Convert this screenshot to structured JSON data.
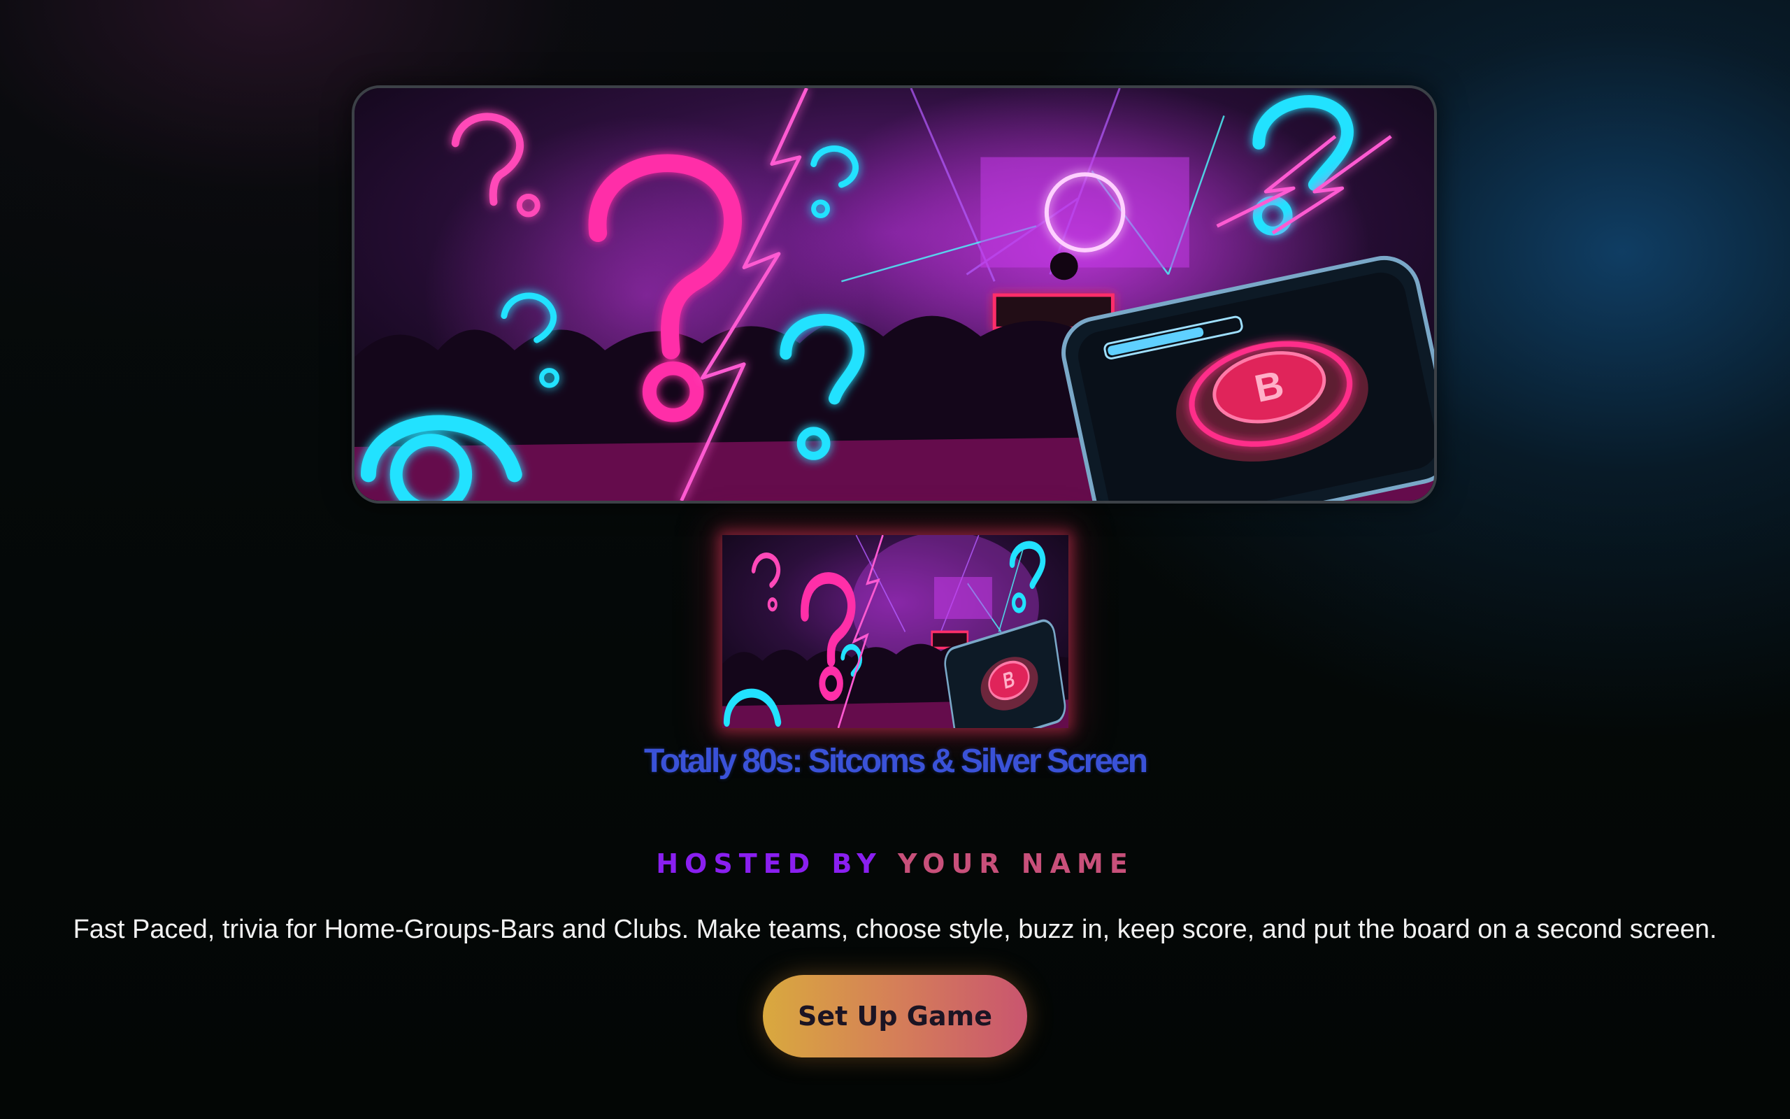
{
  "game": {
    "title": "Totally 80s: Sitcoms & Silver Screen",
    "hosted_by_label": "HOSTED BY",
    "host_name": "YOUR NAME",
    "description": "Fast Paced, trivia for Home-Groups-Bars and Clubs. Make teams, choose style, buzz in, keep score, and put the board on a second screen.",
    "cta_label": "Set Up Game"
  },
  "artwork": {
    "subject": "neon question marks, nightclub crowd, smartphone buzzer",
    "buzzer_letter": "B"
  },
  "colors": {
    "title": "#3a52d8",
    "hosted_by": "#8a1ff0",
    "host_name": "#c8507a",
    "neon_pink": "#ff2fa8",
    "neon_cyan": "#22e2ff",
    "button_start": "#d9a93e",
    "button_end": "#c9556f"
  }
}
